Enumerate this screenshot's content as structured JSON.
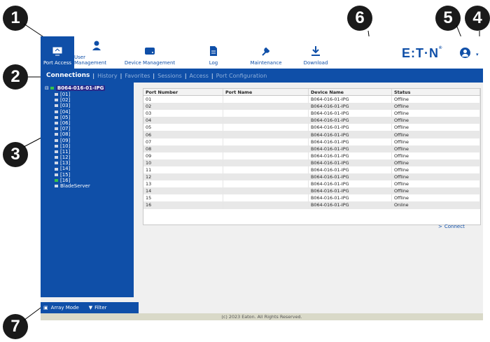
{
  "callouts": [
    "1",
    "2",
    "3",
    "4",
    "5",
    "6",
    "7"
  ],
  "nav": {
    "items": [
      {
        "label": "Port Access",
        "icon": "port-access-icon"
      },
      {
        "label": "User Management",
        "icon": "user-icon"
      },
      {
        "label": "Device Management",
        "icon": "device-icon"
      },
      {
        "label": "Log",
        "icon": "log-icon"
      },
      {
        "label": "Maintenance",
        "icon": "wrench-icon"
      },
      {
        "label": "Download",
        "icon": "download-icon"
      }
    ]
  },
  "brand": {
    "logo": "E:T·N",
    "reg": "®",
    "chevron": "▾"
  },
  "subnav": {
    "tabs": [
      "Connections",
      "History",
      "Favorites",
      "Sessions",
      "Access",
      "Port Configuration"
    ],
    "separator": "|"
  },
  "sidebar": {
    "root": "B064-016-01-IPG",
    "ports": [
      "[01]",
      "[02]",
      "[03]",
      "[04]",
      "[05]",
      "[06]",
      "[07]",
      "[08]",
      "[09]",
      "[10]",
      "[11]",
      "[12]",
      "[13]",
      "[14]",
      "[15]",
      "[16]"
    ],
    "extra": "BladeServer",
    "array_mode": "Array Mode",
    "filter": "Filter"
  },
  "table": {
    "headers": [
      "Port Number",
      "Port Name",
      "Device Name",
      "Status"
    ],
    "rows": [
      [
        "01",
        "",
        "B064-016-01-IPG",
        "Offline"
      ],
      [
        "02",
        "",
        "B064-016-01-IPG",
        "Offline"
      ],
      [
        "03",
        "",
        "B064-016-01-IPG",
        "Offline"
      ],
      [
        "04",
        "",
        "B064-016-01-IPG",
        "Offline"
      ],
      [
        "05",
        "",
        "B064-016-01-IPG",
        "Offline"
      ],
      [
        "06",
        "",
        "B064-016-01-IPG",
        "Offline"
      ],
      [
        "07",
        "",
        "B064-016-01-IPG",
        "Offline"
      ],
      [
        "08",
        "",
        "B064-016-01-IPG",
        "Offline"
      ],
      [
        "09",
        "",
        "B064-016-01-IPG",
        "Offline"
      ],
      [
        "10",
        "",
        "B064-016-01-IPG",
        "Offline"
      ],
      [
        "11",
        "",
        "B064-016-01-IPG",
        "Offline"
      ],
      [
        "12",
        "",
        "B064-016-01-IPG",
        "Offline"
      ],
      [
        "13",
        "",
        "B064-016-01-IPG",
        "Offline"
      ],
      [
        "14",
        "",
        "B064-016-01-IPG",
        "Offline"
      ],
      [
        "15",
        "",
        "B064-016-01-IPG",
        "Offline"
      ],
      [
        "16",
        "",
        "B064-016-01-IPG",
        "Online"
      ]
    ]
  },
  "connect_label": "Connect",
  "footer": "(c) 2023 Eaton. All Rights Reserved.",
  "colors": {
    "brand_blue": "#0f4fa8",
    "online_green": "#37c24a"
  }
}
